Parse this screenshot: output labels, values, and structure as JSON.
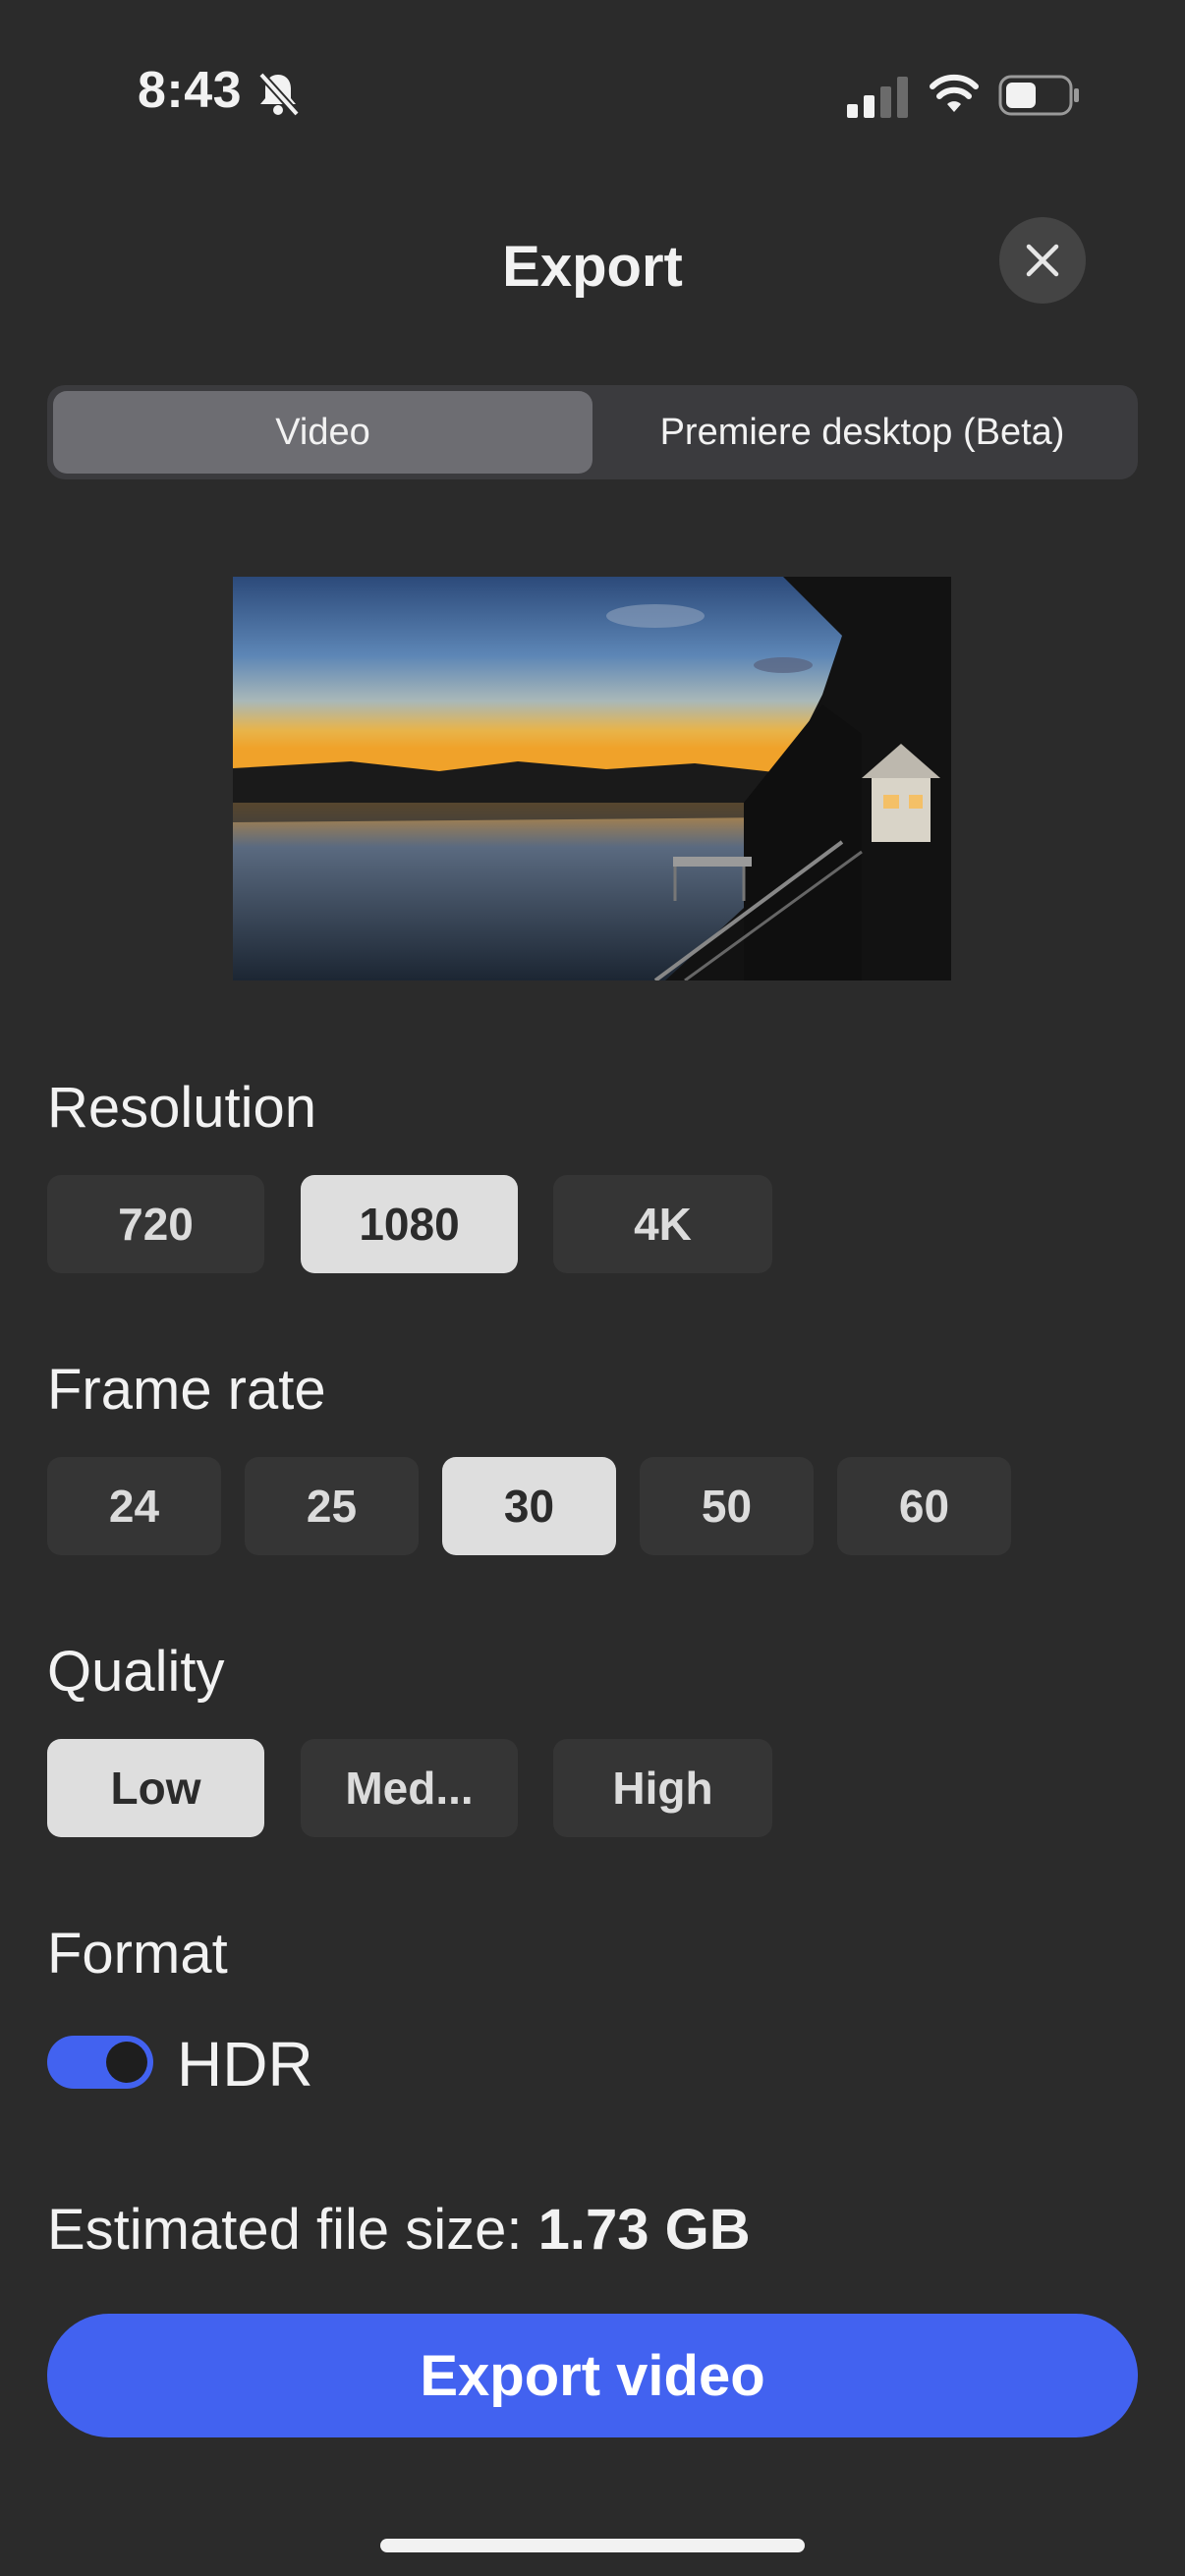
{
  "status_bar": {
    "time": "8:43",
    "icons": [
      "bell-slash-icon",
      "cellular-signal-icon",
      "wifi-icon",
      "battery-icon"
    ]
  },
  "header": {
    "title": "Export",
    "close_icon": "close-icon"
  },
  "tabs": [
    {
      "label": "Video",
      "active": true
    },
    {
      "label": "Premiere desktop (Beta)",
      "active": false
    }
  ],
  "resolution": {
    "label": "Resolution",
    "options": [
      "720",
      "1080",
      "4K"
    ],
    "selected": "1080"
  },
  "frame_rate": {
    "label": "Frame rate",
    "options": [
      "24",
      "25",
      "30",
      "50",
      "60"
    ],
    "selected": "30"
  },
  "quality": {
    "label": "Quality",
    "options": [
      "Low",
      "Med...",
      "High"
    ],
    "selected": "Low"
  },
  "format": {
    "label": "Format",
    "hdr_label": "HDR",
    "hdr_enabled": true
  },
  "file_size": {
    "prefix": "Estimated file size: ",
    "value": "1.73 GB"
  },
  "export_button": {
    "label": "Export video"
  },
  "colors": {
    "background": "#2b2b2b",
    "accent": "#4262f0",
    "option_bg": "#353535",
    "option_selected_bg": "#dedede"
  }
}
